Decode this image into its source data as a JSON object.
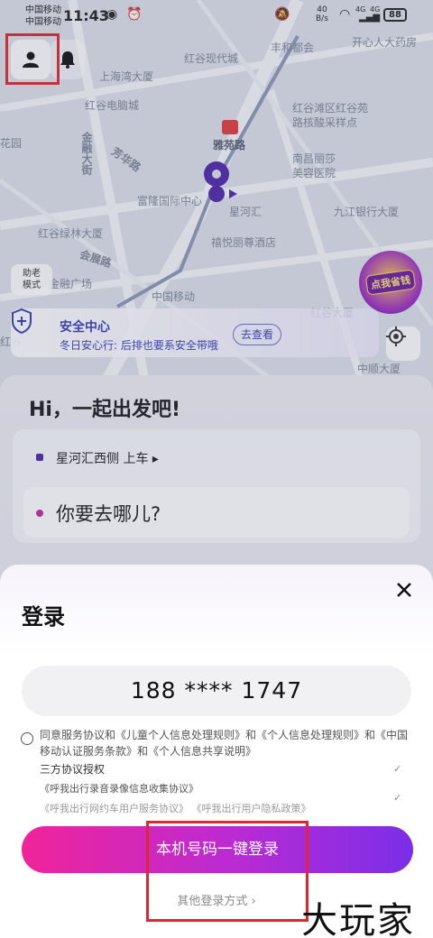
{
  "status_bar": {
    "carrier_1": "中国移动",
    "carrier_2": "中国移动",
    "time": "11:43",
    "net_speed_value": "40",
    "net_speed_unit": "B/s",
    "signal_1": "4G",
    "signal_2": "4G",
    "battery": "88"
  },
  "map": {
    "labels": {
      "fenghe": "丰和都会",
      "kaixin": "开心人大药房",
      "shanghai_bay": "上海湾大厦",
      "honggu_modern": "红谷现代城",
      "honggu_mall": "红谷电脑城",
      "yayuan_road": "雅苑路",
      "honggu_nucleic": "红谷滩区红谷苑\n路核酸采样点",
      "huayuan": "花园",
      "huijin_ave": "金融大街",
      "fangwei_road": "芳华路",
      "fulong": "富隆国际中心",
      "nanchang_lisha": "南昌丽莎\n美容医院",
      "xinghehui": "星河汇",
      "jiujiang_bank": "九江银行大厦",
      "honggu_green": "红谷绿林大厦",
      "jingyue_hotel": "禧悦丽尊酒店",
      "huizhan_road": "会展路",
      "jinrong_square": "金融广场",
      "china_mobile": "中国移动",
      "honggu_tower": "红谷大厦",
      "honggu_left": "红谷",
      "zhongshan": "中顺大厦"
    },
    "assist_mode": "助老\n模式",
    "ad_badge": "点我省钱"
  },
  "safety_banner": {
    "title": "安全中心",
    "subtitle": "冬日安心行: 后排也要系安全带哦",
    "button": "去查看"
  },
  "home": {
    "greeting": "Hi，一起出发吧!",
    "pickup_location": "星河汇西侧",
    "pickup_suffix": "上车 ▸",
    "destination_placeholder": "你要去哪儿?"
  },
  "login": {
    "title": "登录",
    "phone_number": "188 **** 1747",
    "agreement_prefix": "同意",
    "agreement_items": [
      "服务协议",
      "《儿童个人信息处理规则》",
      "《个人信息处理规则》",
      "《中国移动认证服务条款》",
      "《个人信息共享说明》"
    ],
    "agreement_text": "同意服务协议和《儿童个人信息处理规则》和《个人信息处理规则》和《中国移动认证服务条款》和《个人信息共享说明》",
    "third_party_title": "三方协议授权",
    "third_party_item_1": "《呼我出行录音录像信息收集协议》",
    "third_party_item_2": "《呼我出行网约车用户服务协议》 《呼我出行用户隐私政策》",
    "login_button": "本机号码一键登录",
    "other_login": "其他登录方式 ›"
  },
  "watermark": "大玩家",
  "colors": {
    "brand_purple": "#4c25a8",
    "login_gradient_start": "#f0249a",
    "login_gradient_end": "#7a2ee8",
    "annotation_red": "#e0262e"
  }
}
